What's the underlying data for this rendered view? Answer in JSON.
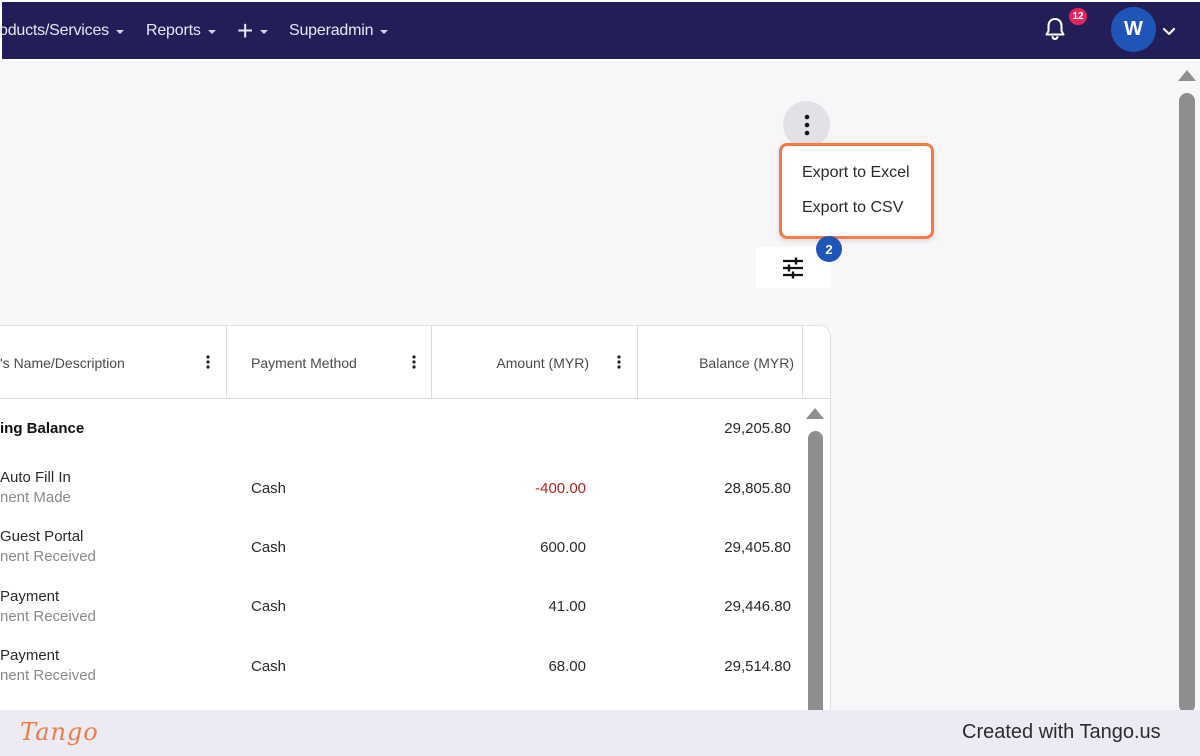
{
  "nav": {
    "items": [
      {
        "label": "oducts/Services"
      },
      {
        "label": "Reports"
      },
      {
        "label": "Superadmin"
      }
    ],
    "notifications_count": "12",
    "avatar_initial": "W"
  },
  "menu": {
    "export_excel": "Export to Excel",
    "export_csv": "Export to CSV"
  },
  "filter": {
    "badge_count": "2"
  },
  "table": {
    "columns": [
      {
        "label": "'s Name/Description"
      },
      {
        "label": "Payment Method"
      },
      {
        "label": "Amount (MYR)"
      },
      {
        "label": "Balance (MYR)"
      }
    ],
    "opening_row": {
      "label": "ing Balance",
      "balance": "29,205.80"
    },
    "rows": [
      {
        "name": "Auto Fill In",
        "type": "nent Made",
        "method": "Cash",
        "amount": "-400.00",
        "balance": "28,805.80"
      },
      {
        "name": "Guest Portal",
        "type": "nent Received",
        "method": "Cash",
        "amount": "600.00",
        "balance": "29,405.80"
      },
      {
        "name": "Payment",
        "type": "nent Received",
        "method": "Cash",
        "amount": "41.00",
        "balance": "29,446.80"
      },
      {
        "name": "Payment",
        "type": "nent Received",
        "method": "Cash",
        "amount": "68.00",
        "balance": "29,514.80"
      }
    ]
  },
  "footer": {
    "logo": "Tango",
    "created_with": "Created with Tango.us"
  },
  "colors": {
    "nav_bg": "#221f58",
    "accent_orange": "#f47c44",
    "badge_blue": "#1f55b6",
    "notification_red": "#e5245c",
    "negative_amount": "#b02525"
  }
}
